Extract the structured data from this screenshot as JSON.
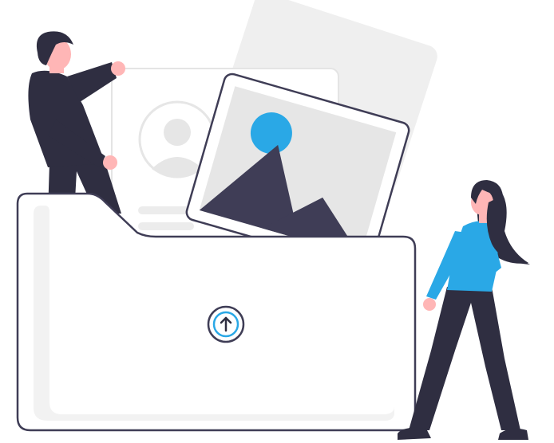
{
  "illustration": {
    "name": "upload-files-illustration",
    "colors": {
      "accent": "#2aa8e6",
      "dark": "#2f2e41",
      "skin": "#ffb6b6",
      "card_back": "#f0f0f0",
      "card_border": "#3f3d56",
      "folder_fill": "#ffffff",
      "folder_inner": "#f2f2f2",
      "image_bg": "#e6e6e6",
      "avatar_gray": "#e6e6e6"
    },
    "icons": {
      "upload": "arrow-up-circle-icon",
      "avatar": "user-avatar-icon",
      "image": "image-mountain-icon"
    }
  }
}
